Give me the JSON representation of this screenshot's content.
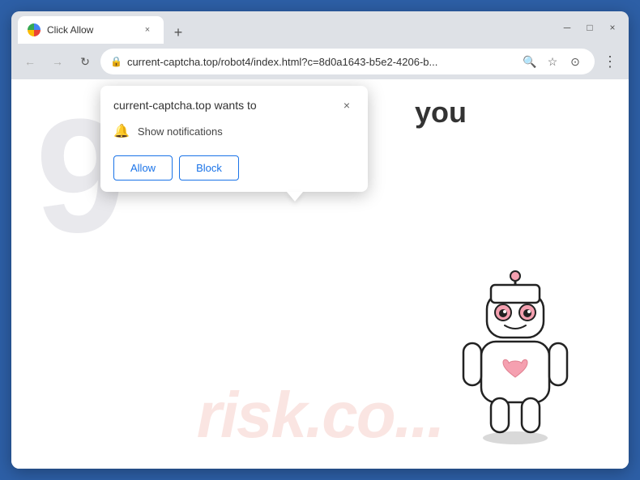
{
  "browser": {
    "title": "Click Allow",
    "tab_close": "×",
    "new_tab": "+",
    "window_minimize": "─",
    "window_maximize": "□",
    "window_close": "×",
    "chevron_down": "⌄",
    "nav": {
      "back_arrow": "←",
      "forward_arrow": "→",
      "refresh": "↻"
    },
    "address": {
      "lock_symbol": "🔒",
      "url": "current-captcha.top/robot4/index.html?c=8d0a1643-b5e2-4206-b..."
    },
    "address_icons": {
      "search": "🔍",
      "star": "☆",
      "profile": "⊙",
      "menu": "⋮"
    }
  },
  "popup": {
    "title": "current-captcha.top wants to",
    "close_btn": "×",
    "notification_label": "Show notifications",
    "allow_label": "Allow",
    "block_label": "Block"
  },
  "page": {
    "you_text": "you",
    "watermark": "risk.co...",
    "bg_number": "9"
  }
}
